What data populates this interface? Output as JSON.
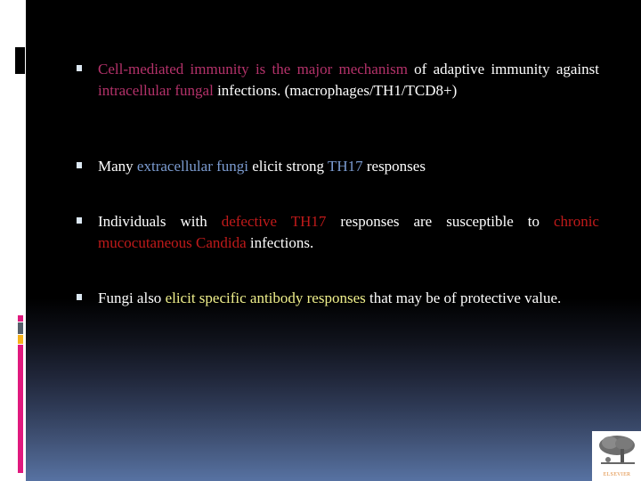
{
  "slide": {
    "bullets": [
      {
        "segments": [
          {
            "text": "Cell-mediated immunity is the major mechanism",
            "color": "magenta"
          },
          {
            "text": " of adaptive immunity against ",
            "color": "white"
          },
          {
            "text": "intracellular fungal",
            "color": "magenta"
          },
          {
            "text": " infections. (macrophages/TH1/TCD8+)",
            "color": "white"
          }
        ]
      },
      {
        "segments": [
          {
            "text": "Many ",
            "color": "white"
          },
          {
            "text": "extracellular fungi",
            "color": "blue"
          },
          {
            "text": " elicit strong ",
            "color": "white"
          },
          {
            "text": "TH17",
            "color": "blue"
          },
          {
            "text": " responses",
            "color": "white"
          }
        ]
      },
      {
        "segments": [
          {
            "text": "Individuals with ",
            "color": "white"
          },
          {
            "text": "defective TH17",
            "color": "red"
          },
          {
            "text": " responses are susceptible to ",
            "color": "white"
          },
          {
            "text": "chronic mucocutaneous Candida",
            "color": "red"
          },
          {
            "text": " infections.",
            "color": "white"
          }
        ]
      },
      {
        "segments": [
          {
            "text": "Fungi also ",
            "color": "white"
          },
          {
            "text": "elicit specific antibody responses",
            "color": "yellow"
          },
          {
            "text": " that may be of protective value.",
            "color": "white"
          }
        ]
      }
    ]
  },
  "logo": {
    "name": "ELSEVIER",
    "icon": "elsevier-tree-icon"
  },
  "colors": {
    "magenta": "#b4326a",
    "blue": "#7b9bd0",
    "red": "#c01a1a",
    "yellow": "#f0f08c",
    "accent_pink": "#e0197e",
    "accent_orange": "#f6b21b",
    "accent_gray": "#555f6b"
  }
}
